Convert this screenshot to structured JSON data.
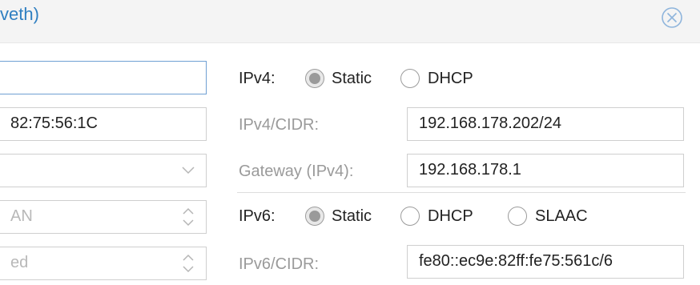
{
  "window": {
    "title": "veth)"
  },
  "left": {
    "name_value": "",
    "mac_value": "82:75:56:1C",
    "bridge_value": "",
    "vlan_placeholder": "AN",
    "rate_placeholder": "ed"
  },
  "ipv4": {
    "label": "IPv4:",
    "static_label": "Static",
    "dhcp_label": "DHCP",
    "selected": "Static",
    "cidr_label": "IPv4/CIDR:",
    "cidr_value": "192.168.178.202/24",
    "gateway_label": "Gateway (IPv4):",
    "gateway_value": "192.168.178.1"
  },
  "ipv6": {
    "label": "IPv6:",
    "static_label": "Static",
    "dhcp_label": "DHCP",
    "slaac_label": "SLAAC",
    "selected": "Static",
    "cidr_label": "IPv6/CIDR:",
    "cidr_value": "fe80::ec9e:82ff:fe75:561c/6"
  },
  "icons": {
    "close": "close-circle-icon",
    "dropdown": "chevron-down-icon",
    "spinner": "up-down-chevron-icon"
  },
  "colors": {
    "title": "#2f7fc1",
    "focus_border": "#6fa0d3",
    "titlebar_bg": "#f4f4f4"
  }
}
